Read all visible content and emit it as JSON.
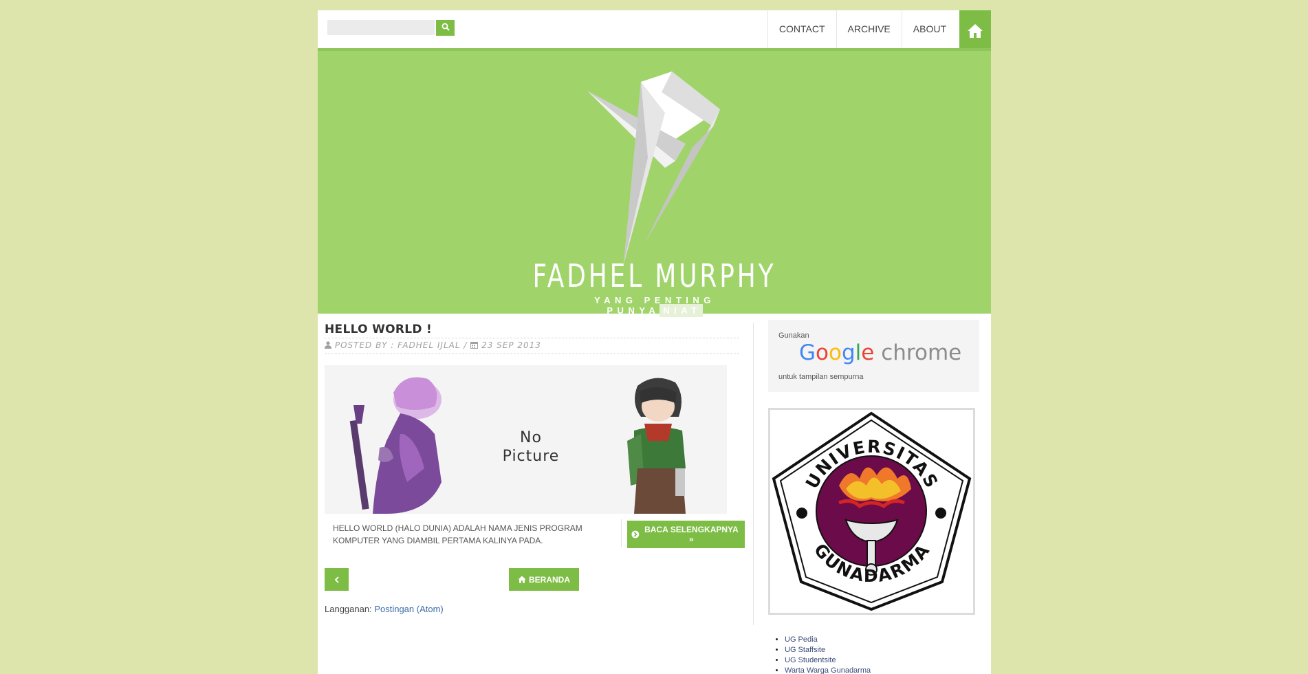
{
  "topbar": {
    "search_placeholder": "",
    "nav": [
      {
        "label": "CONTACT"
      },
      {
        "label": "ARCHIVE"
      },
      {
        "label": "ABOUT"
      }
    ]
  },
  "header": {
    "title": "FADHEL MURPHY",
    "tagline_main": "YANG PENTING PUNYA",
    "tagline_highlight": "NIAT"
  },
  "post": {
    "title": "HELLO WORLD !",
    "meta_author": "POSTED BY : FADHEL IJLAL",
    "meta_sep": "/",
    "meta_date": "23 SEP 2013",
    "image_text_line1": "No",
    "image_text_line2": "Picture",
    "excerpt": "HELLO WORLD (HALO DUNIA) ADALAH NAMA JENIS PROGRAM KOMPUTER YANG DIAMBIL PERTAMA KALINYA PADA.",
    "read_more": "BACA SELENGKAPNYA »"
  },
  "pager": {
    "home_label": "BERANDA"
  },
  "subscribe": {
    "prefix": "Langganan:",
    "link": "Postingan (Atom)"
  },
  "sidebar": {
    "chrome_top": "Gunakan",
    "chrome_name_google": "Google",
    "chrome_name_chrome": "chrome",
    "chrome_bottom": "untuk tampilan sempurna",
    "ug_logo_top": "UNIVERSITAS",
    "ug_logo_bottom": "GUNADARMA",
    "links": [
      "UG Pedia",
      "UG Staffsite",
      "UG Studentsite",
      "Warta Warga Gunadarma"
    ]
  },
  "colors": {
    "page_bg": "#dde4ac",
    "accent": "#7dbd45",
    "header_bg": "#a0d46b",
    "link": "#3a6ca8"
  },
  "icons": [
    "search-icon",
    "home-icon",
    "user-icon",
    "calendar-icon",
    "arrow-circle-right-icon",
    "chevron-left-icon"
  ]
}
